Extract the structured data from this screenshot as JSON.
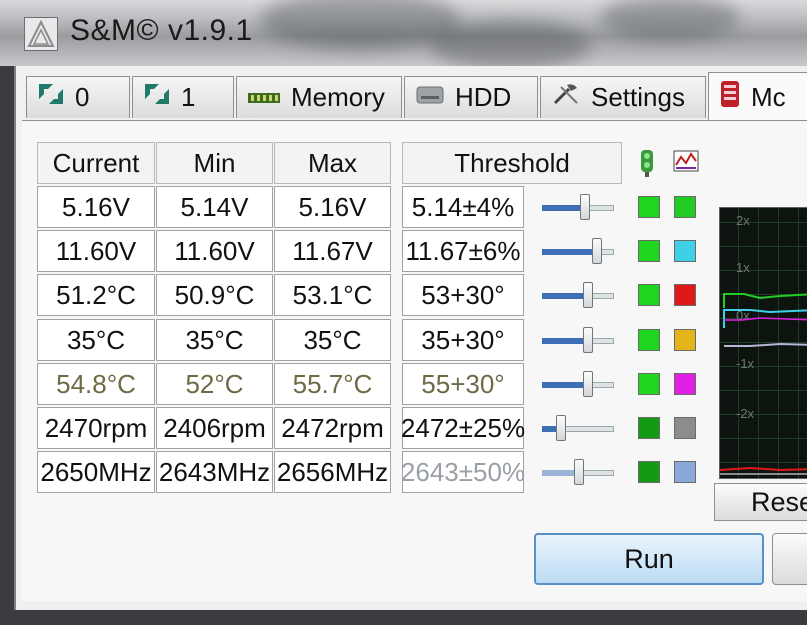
{
  "window": {
    "title": "S&M© v1.9.1"
  },
  "tabs": [
    {
      "label": "0",
      "icon": "cpu-icon"
    },
    {
      "label": "1",
      "icon": "cpu-icon"
    },
    {
      "label": "Memory",
      "icon": "memory-icon"
    },
    {
      "label": "HDD",
      "icon": "hdd-icon"
    },
    {
      "label": "Settings",
      "icon": "settings-icon"
    },
    {
      "label": "Mc",
      "icon": "monitor-icon"
    }
  ],
  "table": {
    "headers": {
      "current": "Current",
      "min": "Min",
      "max": "Max",
      "threshold": "Threshold"
    },
    "rows": [
      {
        "current": "5.16V",
        "min": "5.14V",
        "max": "5.16V",
        "threshold": "5.14±4%",
        "slider": 0.6,
        "status_color": "#1ed61e",
        "series_color": "#22cc22",
        "style": "normal"
      },
      {
        "current": "11.60V",
        "min": "11.60V",
        "max": "11.67V",
        "threshold": "11.67±6%",
        "slider": 0.8,
        "status_color": "#1ed61e",
        "series_color": "#3fd0e8",
        "style": "normal"
      },
      {
        "current": "51.2°C",
        "min": "50.9°C",
        "max": "53.1°C",
        "threshold": "53+30°",
        "slider": 0.65,
        "status_color": "#1ed61e",
        "series_color": "#e01818",
        "style": "normal"
      },
      {
        "current": "35°C",
        "min": "35°C",
        "max": "35°C",
        "threshold": "35+30°",
        "slider": 0.65,
        "status_color": "#1ed61e",
        "series_color": "#e2b51a",
        "style": "normal"
      },
      {
        "current": "54.8°C",
        "min": "52°C",
        "max": "55.7°C",
        "threshold": "55+30°",
        "slider": 0.65,
        "status_color": "#1ed61e",
        "series_color": "#e01ee6",
        "style": "warn"
      },
      {
        "current": "2470rpm",
        "min": "2406rpm",
        "max": "2472rpm",
        "threshold": "2472±25%",
        "slider": 0.2,
        "status_color": "#159a15",
        "series_color": "#8c8c8c",
        "style": "normal"
      },
      {
        "current": "2650MHz",
        "min": "2643MHz",
        "max": "2656MHz",
        "threshold": "2643±50%",
        "slider": 0.5,
        "status_color": "#159a15",
        "series_color": "#8aa8d8",
        "style": "dim"
      }
    ],
    "column_icons": {
      "status": "status-light-icon",
      "color": "color-palette-icon"
    }
  },
  "graph": {
    "labels": [
      "2x",
      "1x",
      "0x",
      "-1x",
      "-2x"
    ]
  },
  "buttons": {
    "reset": "Rese",
    "run": "Run"
  }
}
